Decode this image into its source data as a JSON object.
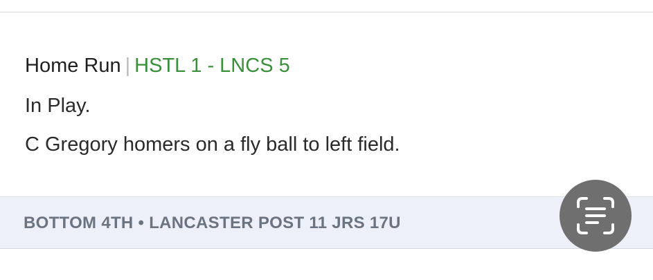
{
  "play": {
    "event": "Home Run",
    "separator": "|",
    "score": "HSTL 1 - LNCS 5",
    "status": "In Play.",
    "description": "C Gregory homers on a fly ball to left field."
  },
  "context": {
    "text": "BOTTOM 4TH • LANCASTER POST 11 JRS 17U"
  },
  "overlay": {
    "icon": "live-text-icon"
  },
  "colors": {
    "score_green": "#3a8f3a",
    "context_bar_bg": "#edf0f8",
    "context_text": "#6b7380",
    "overlay_button_bg": "#6f6f6f"
  }
}
